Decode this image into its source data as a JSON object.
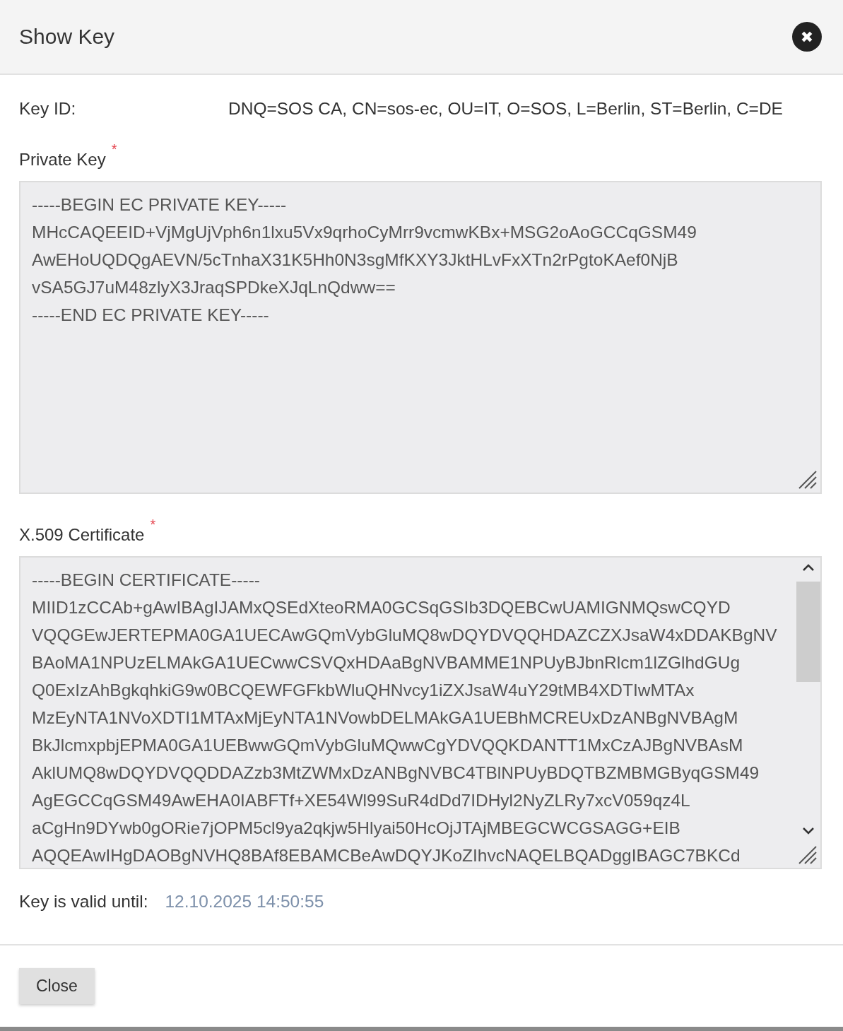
{
  "dialog": {
    "title": "Show Key",
    "close_icon": "✖"
  },
  "key_id": {
    "label": "Key ID:",
    "value": "DNQ=SOS CA, CN=sos-ec, OU=IT, O=SOS, L=Berlin, ST=Berlin, C=DE"
  },
  "private_key": {
    "label": "Private Key",
    "required_mark": "*",
    "lines": [
      "-----BEGIN EC PRIVATE KEY-----",
      "MHcCAQEEID+VjMgUjVph6n1lxu5Vx9qrhoCyMrr9vcmwKBx+MSG2oAoGCCqGSM49",
      "AwEHoUQDQgAEVN/5cTnhaX31K5Hh0N3sgMfKXY3JktHLvFxXTn2rPgtoKAef0NjB",
      "vSA5GJ7uM48zlyX3JraqSPDkeXJqLnQdww==",
      "-----END EC PRIVATE KEY-----"
    ]
  },
  "certificate": {
    "label": "X.509 Certificate",
    "required_mark": "*",
    "scrollbar": true,
    "lines": [
      "-----BEGIN CERTIFICATE-----",
      "MIID1zCCAb+gAwIBAgIJAMxQSEdXteoRMA0GCSqGSIb3DQEBCwUAMIGNMQswCQYD",
      "VQQGEwJERTEPMA0GA1UECAwGQmVybGluMQ8wDQYDVQQHDAZCZXJsaW4xDDAKBgNV",
      "BAoMA1NPUzELMAkGA1UECwwCSVQxHDAaBgNVBAMME1NPUyBJbnRlcm1lZGlhdGUg",
      "Q0ExIzAhBgkqhkiG9w0BCQEWFGFkbWluQHNvcy1iZXJsaW4uY29tMB4XDTIwMTAx",
      "MzEyNTA1NVoXDTI1MTAxMjEyNTA1NVowbDELMAkGA1UEBhMCREUxDzANBgNVBAgM",
      "BkJlcmxpbjEPMA0GA1UEBwwGQmVybGluMQwwCgYDVQQKDANTT1MxCzAJBgNVBAsM",
      "AklUMQ8wDQYDVQQDDAZzb3MtZWMxDzANBgNVBC4TBlNPUyBDQTBZMBMGByqGSM49",
      "AgEGCCqGSM49AwEHA0IABFTf+XE54Wl99SuR4dDd7IDHyl2NyZLRy7xcV059qz4L",
      "aCgHn9DYwb0gORie7jOPM5cl9ya2qkjw5Hlyai50HcOjJTAjMBEGCWCGSAGG+EIB",
      "AQQEAwIHgDAOBgNVHQ8BAf8EBAMCBeAwDQYJKoZIhvcNAQELBQADggIBAGC7BKCd"
    ]
  },
  "validity": {
    "label": "Key is valid until:",
    "value": "12.10.2025 14:50:55"
  },
  "buttons": [
    {
      "label": "Close"
    }
  ]
}
